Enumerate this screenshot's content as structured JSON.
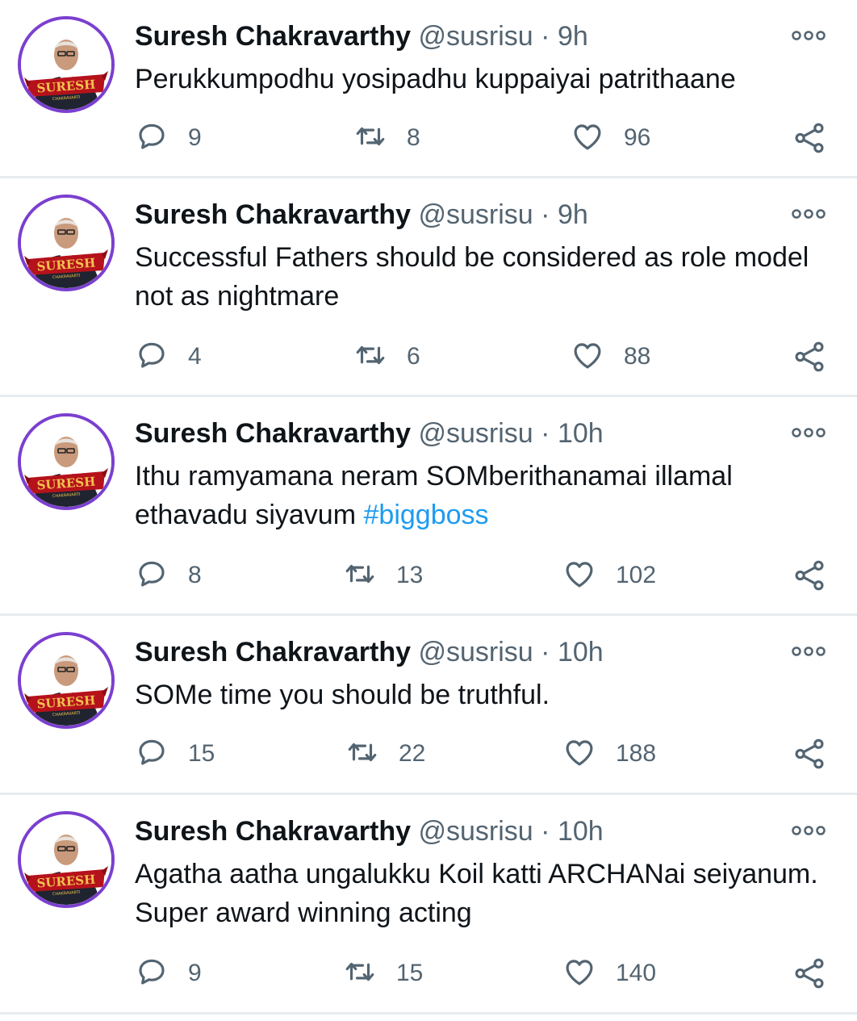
{
  "author": {
    "name": "Suresh Chakravarthy",
    "handle": "@susrisu",
    "avatar_text": "SURESH",
    "avatar_subtext": "CHAKRAVARTI"
  },
  "separator": "·",
  "tweets": [
    {
      "time": "9h",
      "text": "Perukkumpodhu yosipadhu kuppaiyai patrithaane",
      "hashtag": "",
      "replies": "9",
      "retweets": "8",
      "likes": "96"
    },
    {
      "time": "9h",
      "text": "Successful Fathers should be considered as role model not as nightmare",
      "hashtag": "",
      "replies": "4",
      "retweets": "6",
      "likes": "88"
    },
    {
      "time": "10h",
      "text": "Ithu ramyamana neram SOMberithanamai illamal ethavadu siyavum ",
      "hashtag": "#biggboss",
      "replies": "8",
      "retweets": "13",
      "likes": "102"
    },
    {
      "time": "10h",
      "text": "SOMe time you should be truthful.",
      "hashtag": "",
      "replies": "15",
      "retweets": "22",
      "likes": "188"
    },
    {
      "time": "10h",
      "text": "Agatha aatha ungalukku Koil katti ARCHANai seiyanum. Super award winning acting",
      "hashtag": "",
      "replies": "9",
      "retweets": "15",
      "likes": "140"
    }
  ],
  "icons": {
    "reply": "reply-icon",
    "retweet": "retweet-icon",
    "like": "heart-icon",
    "share": "share-icon",
    "more": "more-options-icon"
  },
  "colors": {
    "avatar_ring": "#7b3fd0",
    "hashtag": "#1d9bf0",
    "meta": "#536471",
    "divider": "#e6ecf0"
  }
}
